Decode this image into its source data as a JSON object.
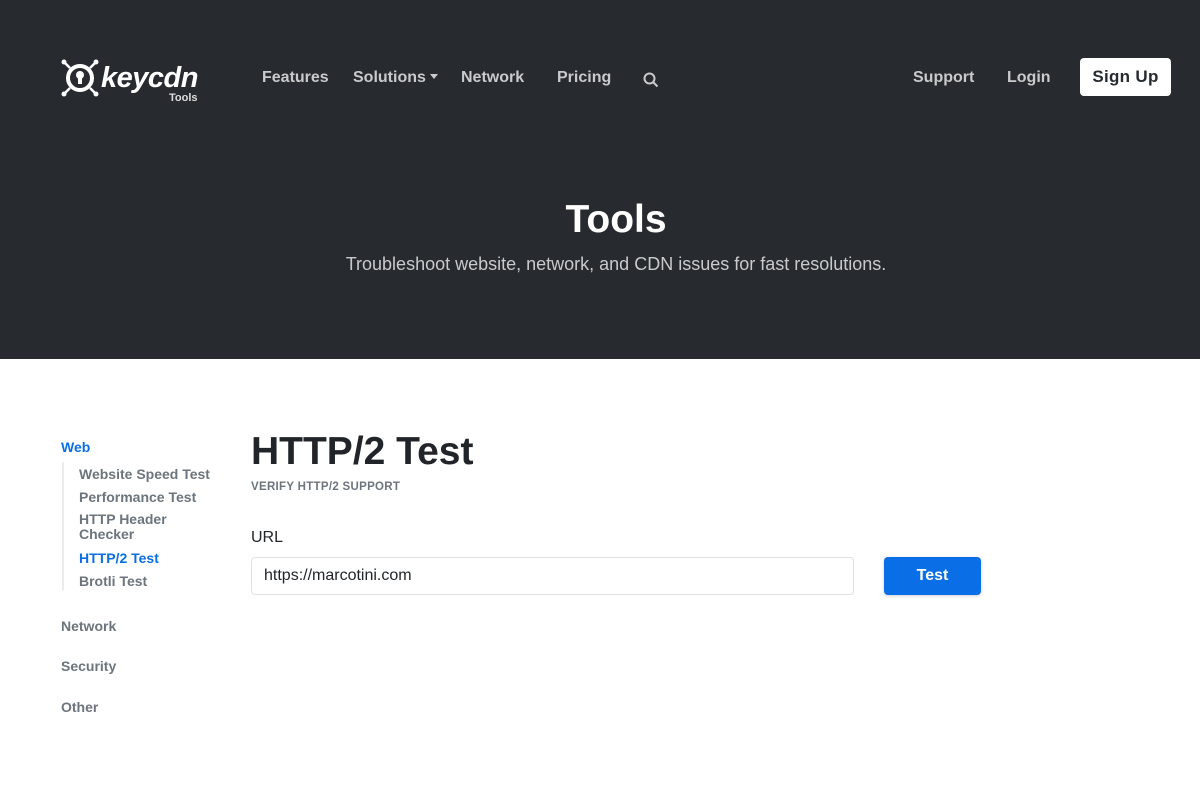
{
  "header": {
    "logo_text": "keycdn",
    "logo_sub": "Tools",
    "nav": [
      "Features",
      "Solutions",
      "Network",
      "Pricing"
    ],
    "support": "Support",
    "login": "Login",
    "signup": "Sign Up"
  },
  "hero": {
    "title": "Tools",
    "subtitle": "Troubleshoot website, network, and CDN issues for fast resolutions."
  },
  "sidebar": {
    "web": "Web",
    "web_items": [
      "Website Speed Test",
      "Performance Test",
      "HTTP Header Checker",
      "HTTP/2 Test",
      "Brotli Test"
    ],
    "network": "Network",
    "security": "Security",
    "other": "Other"
  },
  "main": {
    "title": "HTTP/2 Test",
    "subtitle": "VERIFY HTTP/2 SUPPORT",
    "url_label": "URL",
    "url_value": "https://marcotini.com",
    "test_button": "Test"
  },
  "colors": {
    "hero_bg": "#272b2f",
    "accent": "#0a6fe6"
  }
}
